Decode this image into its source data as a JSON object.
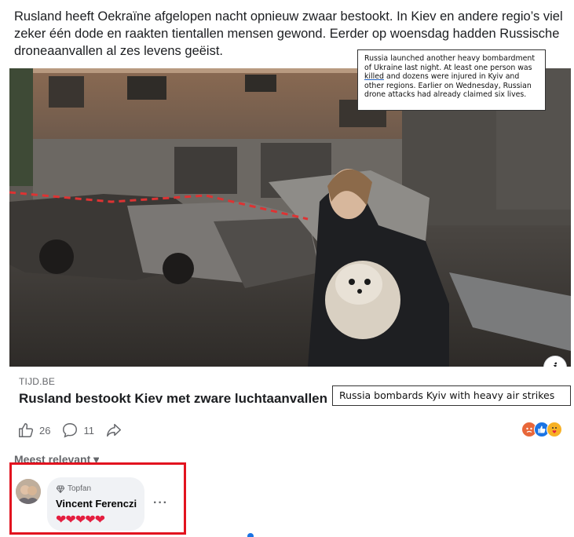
{
  "post": {
    "text": "Rusland heeft Oekraïne afgelopen nacht opnieuw zwaar bestookt. In Kiev en andere regio’s viel zeker één dode en raakten tientallen mensen gewond. Eerder op woensdag hadden Russische droneaanvallen al zes levens geëist."
  },
  "translation_tooltip": {
    "before": "Russia launched another heavy bombardment of Ukraine last night. At least one person was ",
    "highlight": "killed",
    "after": " and dozens were injured in Kyiv and other regions. Earlier on Wednesday, Russian drone attacks had already claimed six lives."
  },
  "photo": {
    "info_icon": "info-icon",
    "info_glyph": "i"
  },
  "link": {
    "domain": "TIJD.BE",
    "title": "Rusland bestookt Kiev met zware luchtaanvallen",
    "title_translation": "Russia bombards Kyiv with heavy air strikes"
  },
  "actions": {
    "like_count": "26",
    "comment_count": "11",
    "like_icon": "thumbs-up-icon",
    "comment_icon": "comment-bubble-icon",
    "share_icon": "share-arrow-icon"
  },
  "reactions": [
    "angry",
    "like",
    "care"
  ],
  "comments": {
    "sort_label": "Meest relevant",
    "items": [
      {
        "badge": "Topfan",
        "author": "Vincent Ferenczi",
        "text": "❤❤❤❤❤",
        "more": "···"
      }
    ]
  },
  "colors": {
    "highlight_box": "#e2131f",
    "link_blue": "#1b74e4",
    "muted": "#65676b"
  }
}
